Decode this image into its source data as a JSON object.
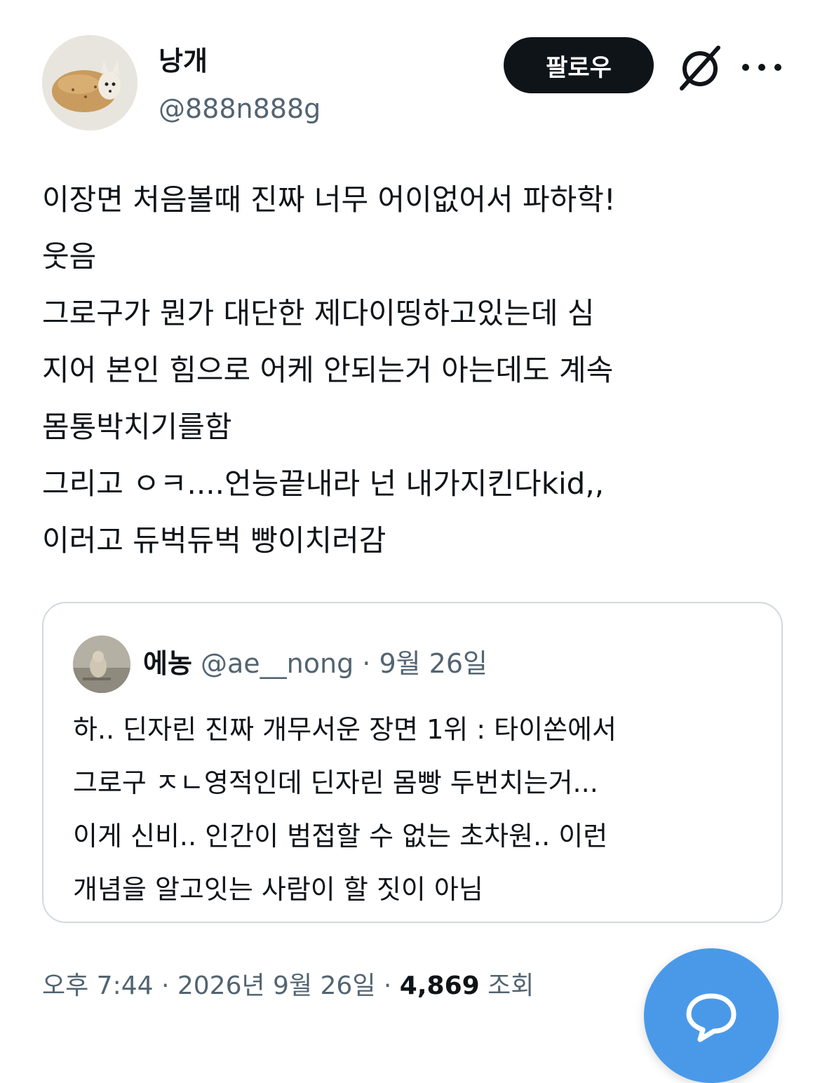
{
  "author": {
    "display_name": "낭개",
    "handle": "@888n888g"
  },
  "actions": {
    "follow_label": "팔로우",
    "grok_icon": "grok-icon",
    "more_icon": "more-icon"
  },
  "tweet": {
    "lines": [
      "이장면 처음볼때 진짜 너무 어이없어서 파하학!",
      "웃음",
      "그로구가 뭔가 대단한 제다이띵하고있는데 심",
      "지어 본인 힘으로 어케 안되는거 아는데도 계속",
      "몸통박치기를함",
      "그리고 ㅇㅋ....언능끝내라 넌 내가지킨다kid,,",
      "이러고 듀벅듀벅 빵이치러감"
    ]
  },
  "quote": {
    "display_name": "에농",
    "handle": "@ae__nong",
    "separator": " · ",
    "date": "9월 26일",
    "lines": [
      "하.. 딘자린 진짜 개무서운 장면 1위 : 타이쏜에서",
      "그로구 ㅈㄴ영적인데 딘자린 몸빵 두번치는거...",
      "이게 신비.. 인간이 범접할 수 없는 초차원.. 이런",
      "개념을 알고잇는 사람이 할 짓이 아님"
    ]
  },
  "meta": {
    "time": "오후 7:44",
    "separator": " · ",
    "date": "2026년 9월 26일",
    "views_count": "4,869",
    "views_label": "조회"
  },
  "colors": {
    "text": "#0f1419",
    "secondary": "#536471",
    "border": "#cfd9de",
    "fab": "#4a99e9"
  }
}
